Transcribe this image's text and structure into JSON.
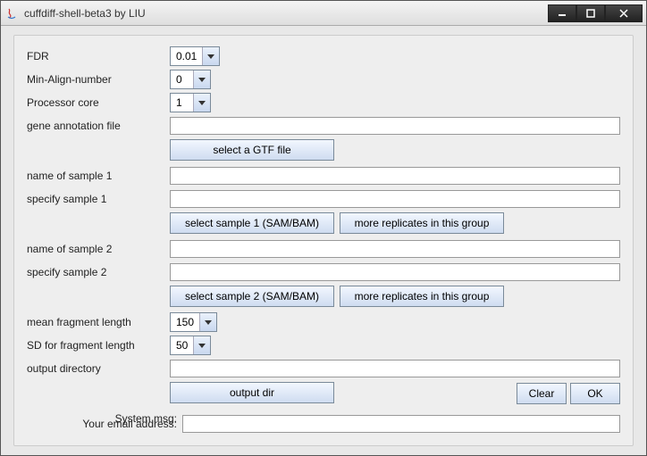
{
  "window": {
    "title": "cuffdiff-shell-beta3 by LIU"
  },
  "form": {
    "fdr": {
      "label": "FDR",
      "value": "0.01"
    },
    "minAlign": {
      "label": "Min-Align-number",
      "value": "0"
    },
    "procCore": {
      "label": "Processor core",
      "value": "1"
    },
    "geneAnnot": {
      "label": "gene annotation file",
      "value": "",
      "button": "select a GTF file"
    },
    "sample1name": {
      "label": "name of sample 1",
      "value": ""
    },
    "sample1spec": {
      "label": "specify sample 1",
      "value": ""
    },
    "sample1btnA": "select sample 1 (SAM/BAM)",
    "sample1btnB": "more replicates in this group",
    "sample2name": {
      "label": "name of sample 2",
      "value": ""
    },
    "sample2spec": {
      "label": "specify sample 2",
      "value": ""
    },
    "sample2btnA": "select sample 2 (SAM/BAM)",
    "sample2btnB": "more replicates in this group",
    "meanFrag": {
      "label": "mean fragment length",
      "value": "150"
    },
    "sdFrag": {
      "label": "SD for fragment length",
      "value": "50"
    },
    "outDir": {
      "label": "output directory",
      "value": "",
      "button": "output dir"
    },
    "sysMsg": {
      "label": "System msg:"
    },
    "email": {
      "label": "Your email address:",
      "value": ""
    }
  },
  "buttons": {
    "clear": "Clear",
    "ok": "OK"
  }
}
